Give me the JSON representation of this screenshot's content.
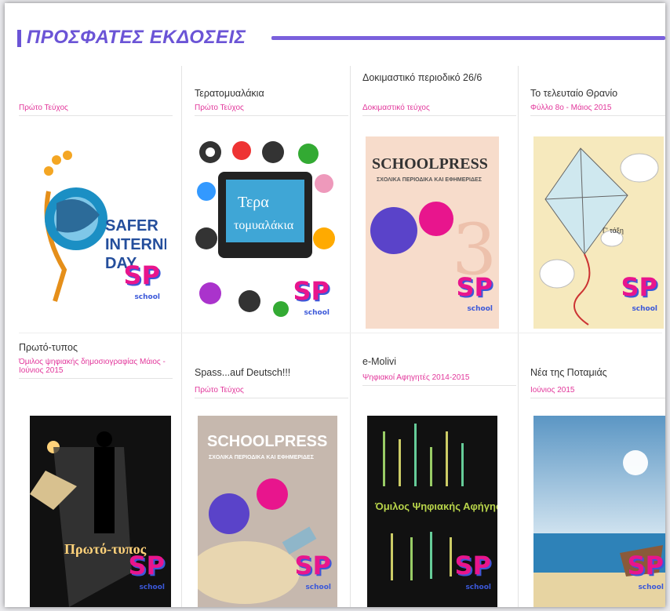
{
  "section": {
    "title": "ΠΡΟΣΦΑΤΕΣ ΕΚΔΟΣΕΙΣ"
  },
  "badge": {
    "mark": "SP",
    "sub": "school"
  },
  "cards": [
    {
      "title": "",
      "meta": "Πρώτο Τεύχος",
      "cover_text": "SAFER INTERNET DAY"
    },
    {
      "title": "Τερατομυαλάκια",
      "meta": "Πρώτο Τεύχος",
      "cover_text": "Τερατομυαλάκια"
    },
    {
      "title": "Δοκιμαστικό περιοδικό 26/6",
      "meta": "Δοκιμαστικό τεύχος",
      "cover_text": "SCHOOLPRESS",
      "cover_sub": "ΣΧΟΛΙΚΑ ΠΕΡΙΟΔΙΚΑ ΚΑΙ ΕΦΗΜΕΡΙΔΕΣ"
    },
    {
      "title": "Το τελευταίο Θρανίο",
      "meta": "Φύλλο 8ο - Μάιος 2015",
      "cover_text": "Γ' τάξη"
    },
    {
      "title": "Πρωτό-τυπος",
      "meta": "Όμιλος ψηφιακής δημοσιογραφίας Μάιος - Ιούνιος 2015",
      "cover_text": "Πρωτό-τυπος"
    },
    {
      "title": "Spass...auf Deutsch!!!",
      "meta": "Πρώτο Τεύχος",
      "cover_text": "SCHOOLPRESS",
      "cover_sub": "ΣΧΟΛΙΚΑ ΠΕΡΙΟΔΙΚΑ ΚΑΙ ΕΦΗΜΕΡΙΔΕΣ"
    },
    {
      "title": "e-Molivi",
      "meta": "Ψηφιακοί Αφηγητές 2014-2015",
      "cover_text": "Όμιλος Ψηφιακής Αφήγησης"
    },
    {
      "title": "Νέα της Ποταμιάς",
      "meta": "Ιούνιος 2015",
      "cover_text": ""
    }
  ]
}
